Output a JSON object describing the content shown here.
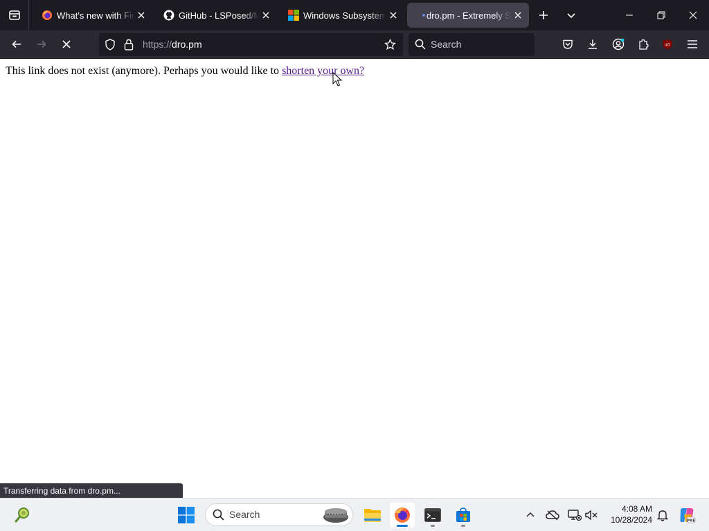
{
  "browser": {
    "tabs": [
      {
        "title": "What's new with Firefox",
        "icon": "firefox-icon",
        "active": false
      },
      {
        "title": "GitHub - LSPosed/Magisk",
        "icon": "github-icon",
        "active": false
      },
      {
        "title": "Windows Subsystem for Android",
        "icon": "windows-logo-icon",
        "active": false
      },
      {
        "title": "dro.pm - Extremely Short",
        "icon": "loading-dot-icon",
        "active": true
      }
    ],
    "url_scheme": "https://",
    "url_host": "dro.pm",
    "search_placeholder": "Search"
  },
  "page": {
    "message_prefix": "This link does not exist (anymore). Perhaps you would like to ",
    "link_text": "shorten your own?"
  },
  "status_text": "Transferring data from dro.pm...",
  "taskbar": {
    "search_label": "Search",
    "time": "4:08 AM",
    "date": "10/28/2024"
  },
  "colors": {
    "tabbar_bg": "#1c1b22",
    "toolbar_bg": "#2b2a33",
    "active_tab_bg": "#42414d",
    "link_visited": "#551a8b",
    "taskbar_bg": "#eef0f4"
  }
}
